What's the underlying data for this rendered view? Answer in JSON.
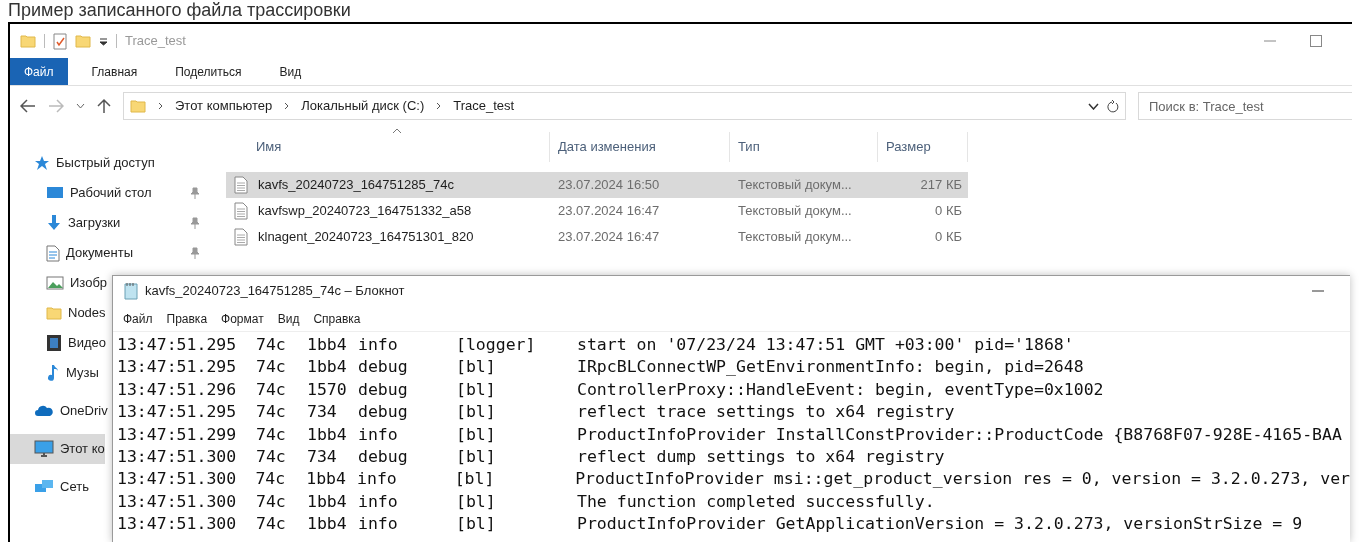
{
  "caption": "Пример записанного файла трассировки",
  "explorer": {
    "title": "Trace_test",
    "ribbon_tabs": [
      {
        "label": "Файл",
        "selected": true
      },
      {
        "label": "Главная",
        "selected": false
      },
      {
        "label": "Поделиться",
        "selected": false
      },
      {
        "label": "Вид",
        "selected": false
      }
    ],
    "address": {
      "breadcrumbs": [
        "Этот компьютер",
        "Локальный диск (C:)",
        "Trace_test"
      ]
    },
    "search": {
      "placeholder": "Поиск в: Trace_test"
    },
    "sidebar": {
      "items": [
        {
          "kind": "star",
          "label": "Быстрый доступ",
          "selected": false,
          "children": [
            {
              "kind": "desktop",
              "label": "Рабочий стол",
              "pinned": true,
              "selected": false
            },
            {
              "kind": "download",
              "label": "Загрузки",
              "pinned": true,
              "selected": false
            },
            {
              "kind": "document",
              "label": "Документы",
              "pinned": true,
              "selected": false
            },
            {
              "kind": "pictures",
              "label": "Изобр",
              "selected": false
            },
            {
              "kind": "folder",
              "label": "Nodes",
              "selected": false
            },
            {
              "kind": "video",
              "label": "Видео",
              "selected": false
            },
            {
              "kind": "music",
              "label": "Музы",
              "selected": false
            }
          ]
        },
        {
          "kind": "cloud",
          "label": "OneDriv",
          "selected": false
        },
        {
          "kind": "computer",
          "label": "Этот ко",
          "selected": true
        },
        {
          "kind": "network",
          "label": "Сеть",
          "selected": false
        }
      ]
    },
    "file_list": {
      "columns": [
        "Имя",
        "Дата изменения",
        "Тип",
        "Размер"
      ],
      "rows": [
        {
          "name": "kavfs_20240723_164751285_74c",
          "date": "23.07.2024 16:50",
          "type": "Текстовый докум...",
          "size": "217 КБ",
          "selected": true
        },
        {
          "name": "kavfswp_20240723_164751332_a58",
          "date": "23.07.2024 16:47",
          "type": "Текстовый докум...",
          "size": "0 КБ",
          "selected": false
        },
        {
          "name": "klnagent_20240723_164751301_820",
          "date": "23.07.2024 16:47",
          "type": "Текстовый докум...",
          "size": "0 КБ",
          "selected": false
        }
      ]
    }
  },
  "notepad": {
    "title": "kavfs_20240723_164751285_74c – Блокнот",
    "menu": [
      "Файл",
      "Правка",
      "Формат",
      "Вид",
      "Справка"
    ],
    "lines": [
      {
        "time": "13:47:51.295",
        "pid": "74c",
        "tid": "1bb4",
        "level": "info",
        "module": "[logger]",
        "message": "start on '07/23/24 13:47:51 GMT +03:00' pid='1868'"
      },
      {
        "time": "13:47:51.295",
        "pid": "74c",
        "tid": "1bb4",
        "level": "debug",
        "module": "[bl]",
        "message": "IRpcBLConnectWP_GetEnvironmentInfo: begin, pid=2648"
      },
      {
        "time": "13:47:51.296",
        "pid": "74c",
        "tid": "1570",
        "level": "debug",
        "module": "[bl]",
        "message": "ControllerProxy::HandleEvent: begin, eventType=0x1002"
      },
      {
        "time": "13:47:51.295",
        "pid": "74c",
        "tid": "734",
        "level": "debug",
        "module": "[bl]",
        "message": "reflect trace settings to x64 registry"
      },
      {
        "time": "13:47:51.299",
        "pid": "74c",
        "tid": "1bb4",
        "level": "info",
        "module": "[bl]",
        "message": "ProductInfoProvider InstallConstProvider::ProductCode {B8768F07-928E-4165-BAA"
      },
      {
        "time": "13:47:51.300",
        "pid": "74c",
        "tid": "734",
        "level": "debug",
        "module": "[bl]",
        "message": "reflect dump settings to x64 registry"
      },
      {
        "time": "13:47:51.300",
        "pid": "74c",
        "tid": "1bb4",
        "level": "info",
        "module": "[bl]",
        "message": "ProductInfoProvider msi::get_product_version res = 0, version = 3.2.0.273, ver"
      },
      {
        "time": "13:47:51.300",
        "pid": "74c",
        "tid": "1bb4",
        "level": "info",
        "module": "[bl]",
        "message": "The function completed successfully."
      },
      {
        "time": "13:47:51.300",
        "pid": "74c",
        "tid": "1bb4",
        "level": "info",
        "module": "[bl]",
        "message": "ProductInfoProvider GetApplicationVersion = 3.2.0.273, versionStrSize = 9"
      }
    ]
  }
}
